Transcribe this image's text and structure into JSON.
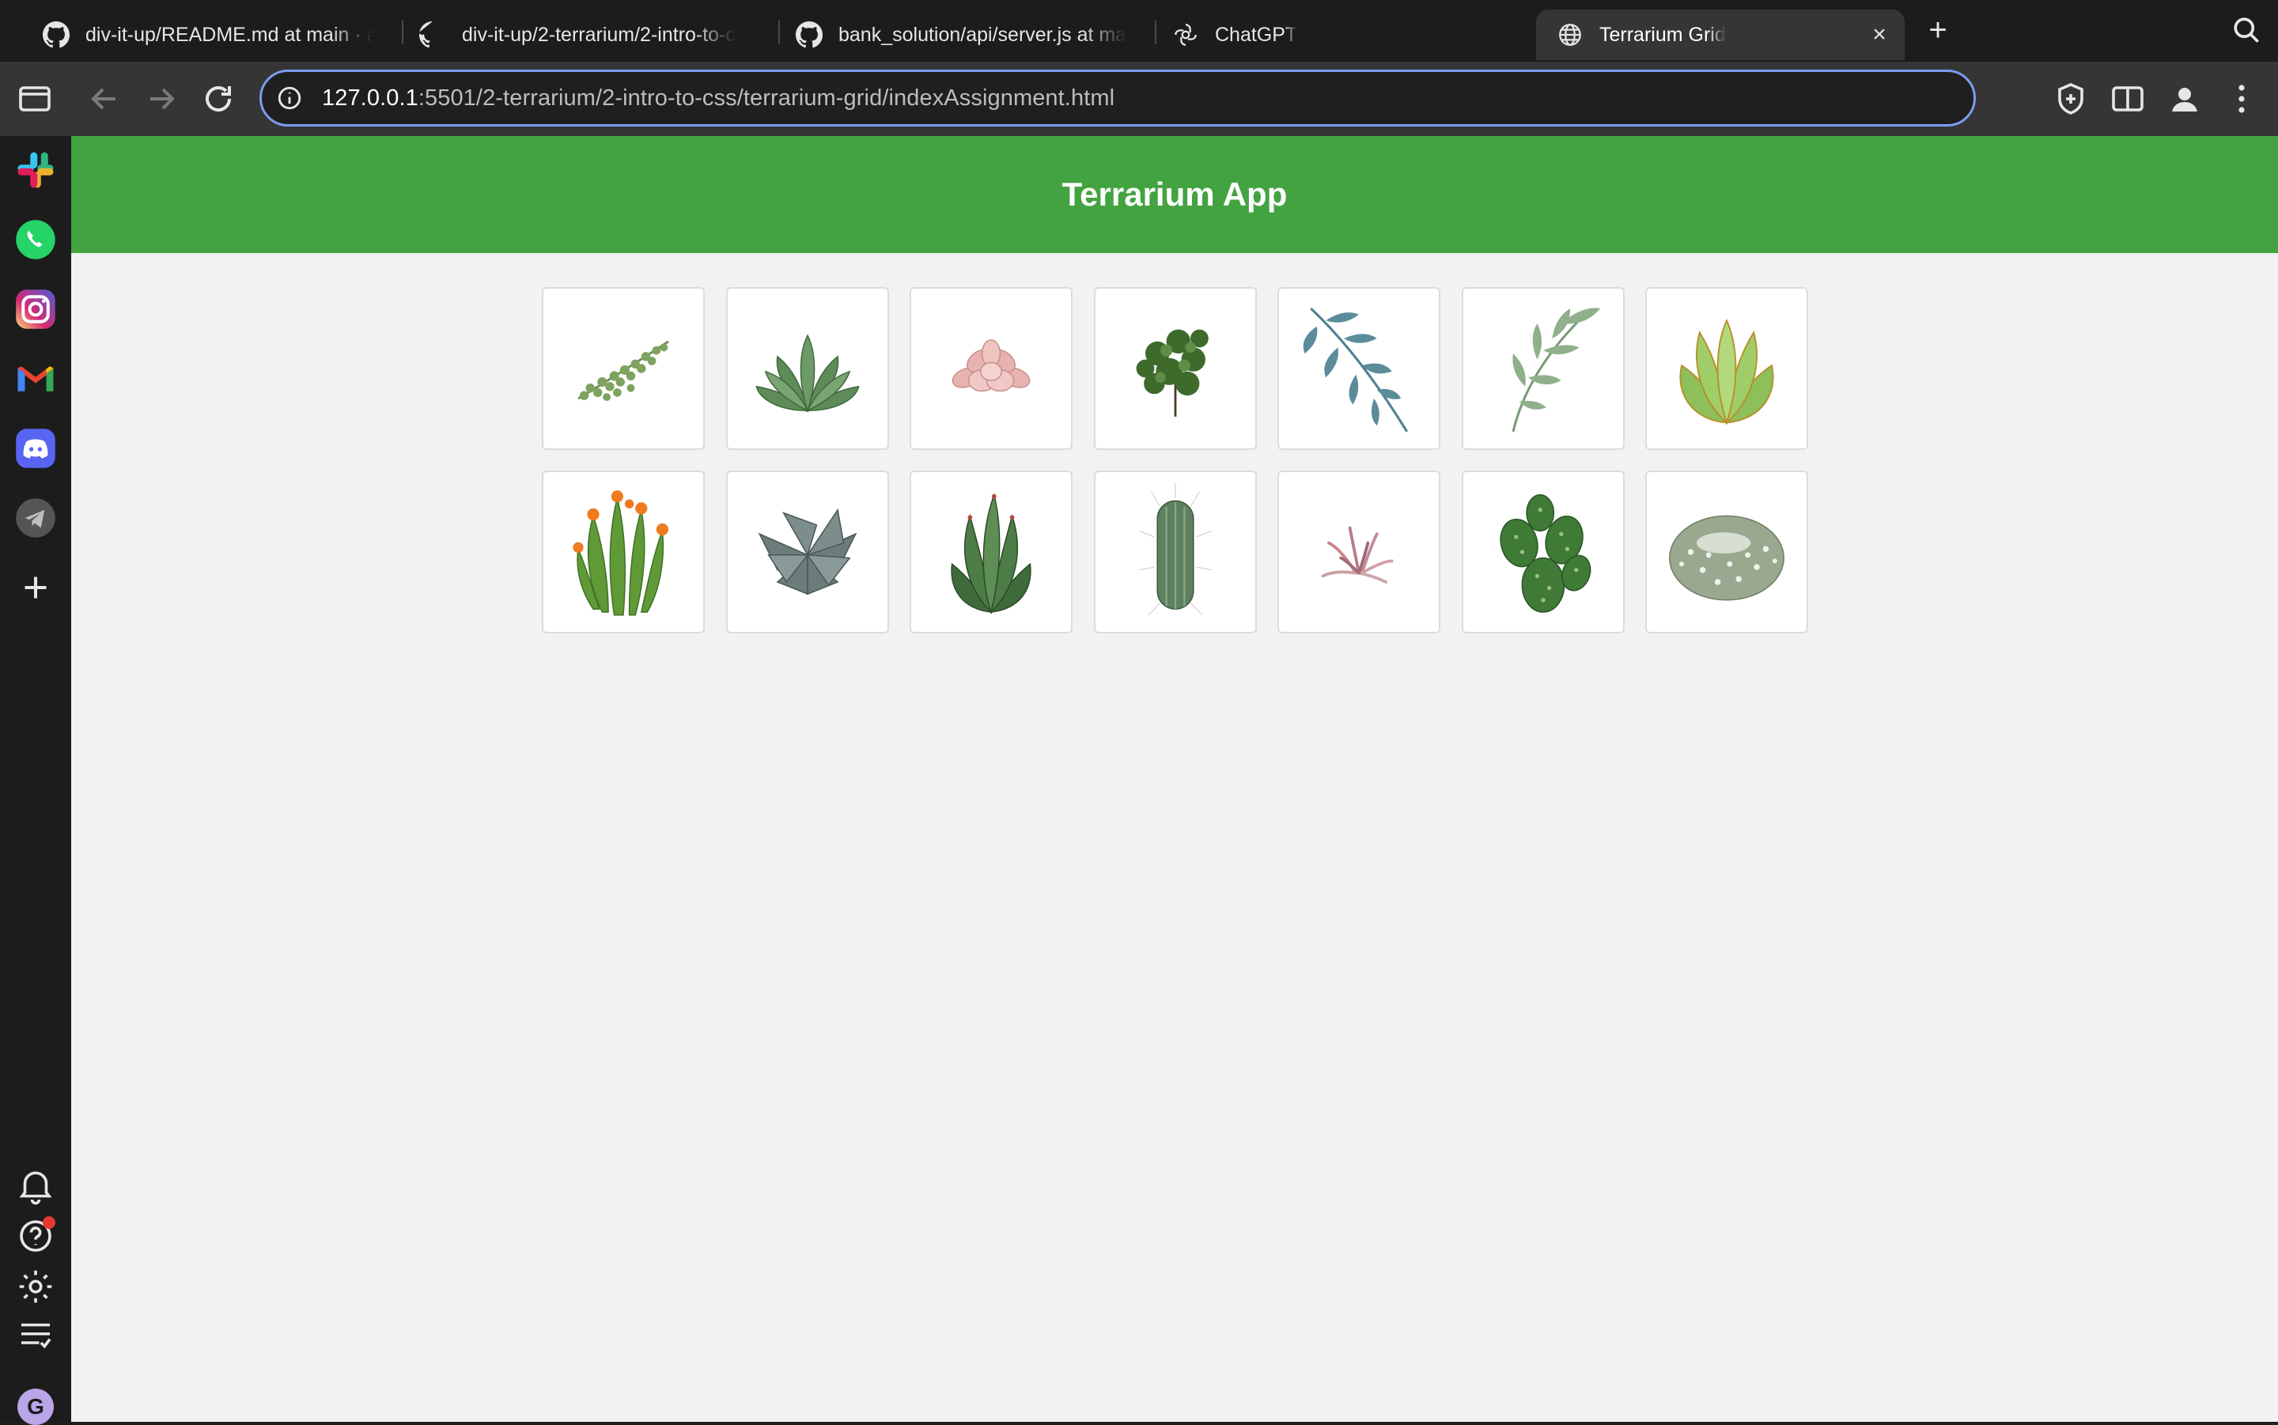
{
  "browser": {
    "tabs": [
      {
        "title": "div-it-up/README.md at main · ar",
        "icon": "github-icon",
        "active": false
      },
      {
        "title": "div-it-up/2-terrarium/2-intro-to-c",
        "icon": "github-icon",
        "active": false
      },
      {
        "title": "bank_solution/api/server.js at mai",
        "icon": "github-icon",
        "active": false
      },
      {
        "title": "ChatGPT",
        "icon": "chatgpt-icon",
        "active": false
      },
      {
        "title": "Terrarium Grid",
        "icon": "globe-icon",
        "active": true
      }
    ],
    "address": {
      "host": "127.0.0.1",
      "path": ":5501/2-terrarium/2-intro-to-css/terrarium-grid/indexAssignment.html"
    }
  },
  "sidebar": {
    "apps": [
      "slack-icon",
      "whatsapp-icon",
      "instagram-icon",
      "gmail-icon",
      "discord-icon",
      "telegram-icon",
      "add-icon"
    ],
    "bottom": [
      "bell-icon",
      "help-icon",
      "settings-icon",
      "reading-list-icon"
    ],
    "avatar_letter": "G"
  },
  "page": {
    "title": "Terrarium App",
    "header_color": "#43a340",
    "background": "#f2f2f2"
  },
  "plants": [
    "trailing-vine",
    "green-succulent",
    "pink-succulent",
    "dark-clover-cluster",
    "blue-leaf-branch",
    "eucalyptus-branch",
    "light-green-echeveria",
    "flowering-cactus",
    "grey-succulent",
    "aloe-agave",
    "spiky-cactus",
    "air-plant",
    "prickly-pear-cactus",
    "fuzzy-round-cactus"
  ]
}
